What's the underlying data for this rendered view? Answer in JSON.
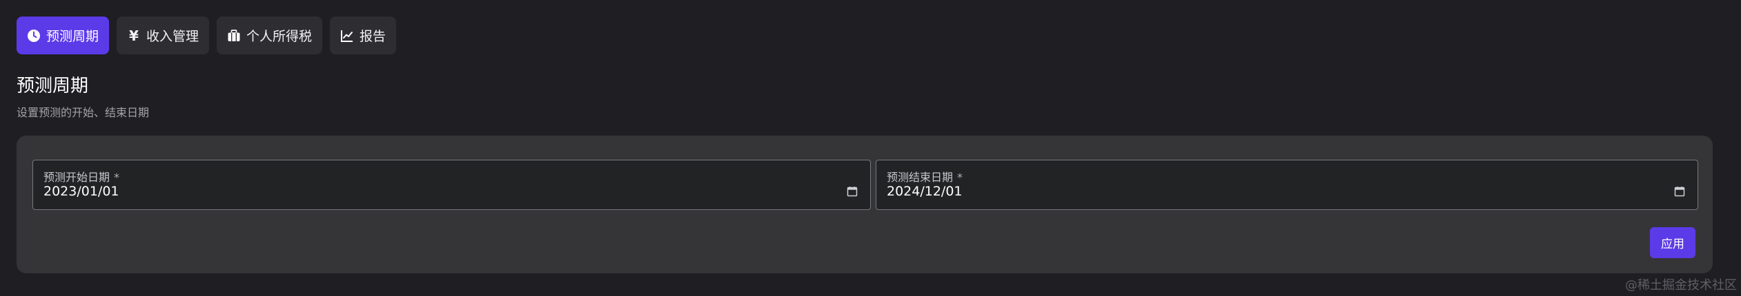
{
  "tabs": [
    {
      "label": "预测周期",
      "icon": "clock-icon",
      "active": true
    },
    {
      "label": "收入管理",
      "icon": "yen-icon",
      "active": false
    },
    {
      "label": "个人所得税",
      "icon": "briefcase-icon",
      "active": false
    },
    {
      "label": "报告",
      "icon": "line-chart-icon",
      "active": false
    }
  ],
  "section": {
    "title": "预测周期",
    "subtitle": "设置预测的开始、结束日期"
  },
  "form": {
    "start_date": {
      "label": "预测开始日期",
      "required_mark": "*",
      "value": "2023/01/01",
      "icon": "calendar-icon"
    },
    "end_date": {
      "label": "预测结束日期",
      "required_mark": "*",
      "value": "2024/12/01",
      "icon": "calendar-icon"
    },
    "apply_label": "应用"
  },
  "icons": {
    "yen_glyph": "¥"
  },
  "watermark": "@稀土掘金技术社区",
  "colors": {
    "background": "#1f1e23",
    "accent": "#5b3be8",
    "card": "#353537",
    "tab": "#2e2e32"
  }
}
